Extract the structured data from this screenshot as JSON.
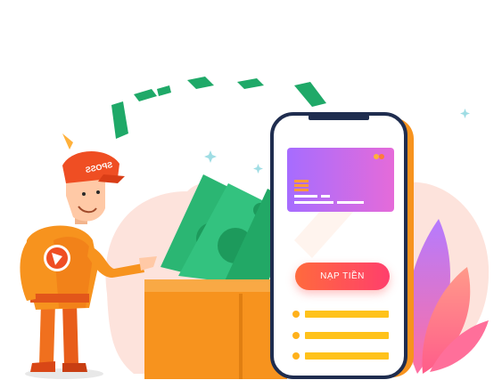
{
  "phone": {
    "deposit_button_label": "NẠP TIỀN"
  },
  "mascot": {
    "cap_text": "SPOSS"
  },
  "colors": {
    "accent": "#ff5a4e",
    "money": "#2bb673",
    "wallet": "#f7931e",
    "card": "#a855f7"
  }
}
